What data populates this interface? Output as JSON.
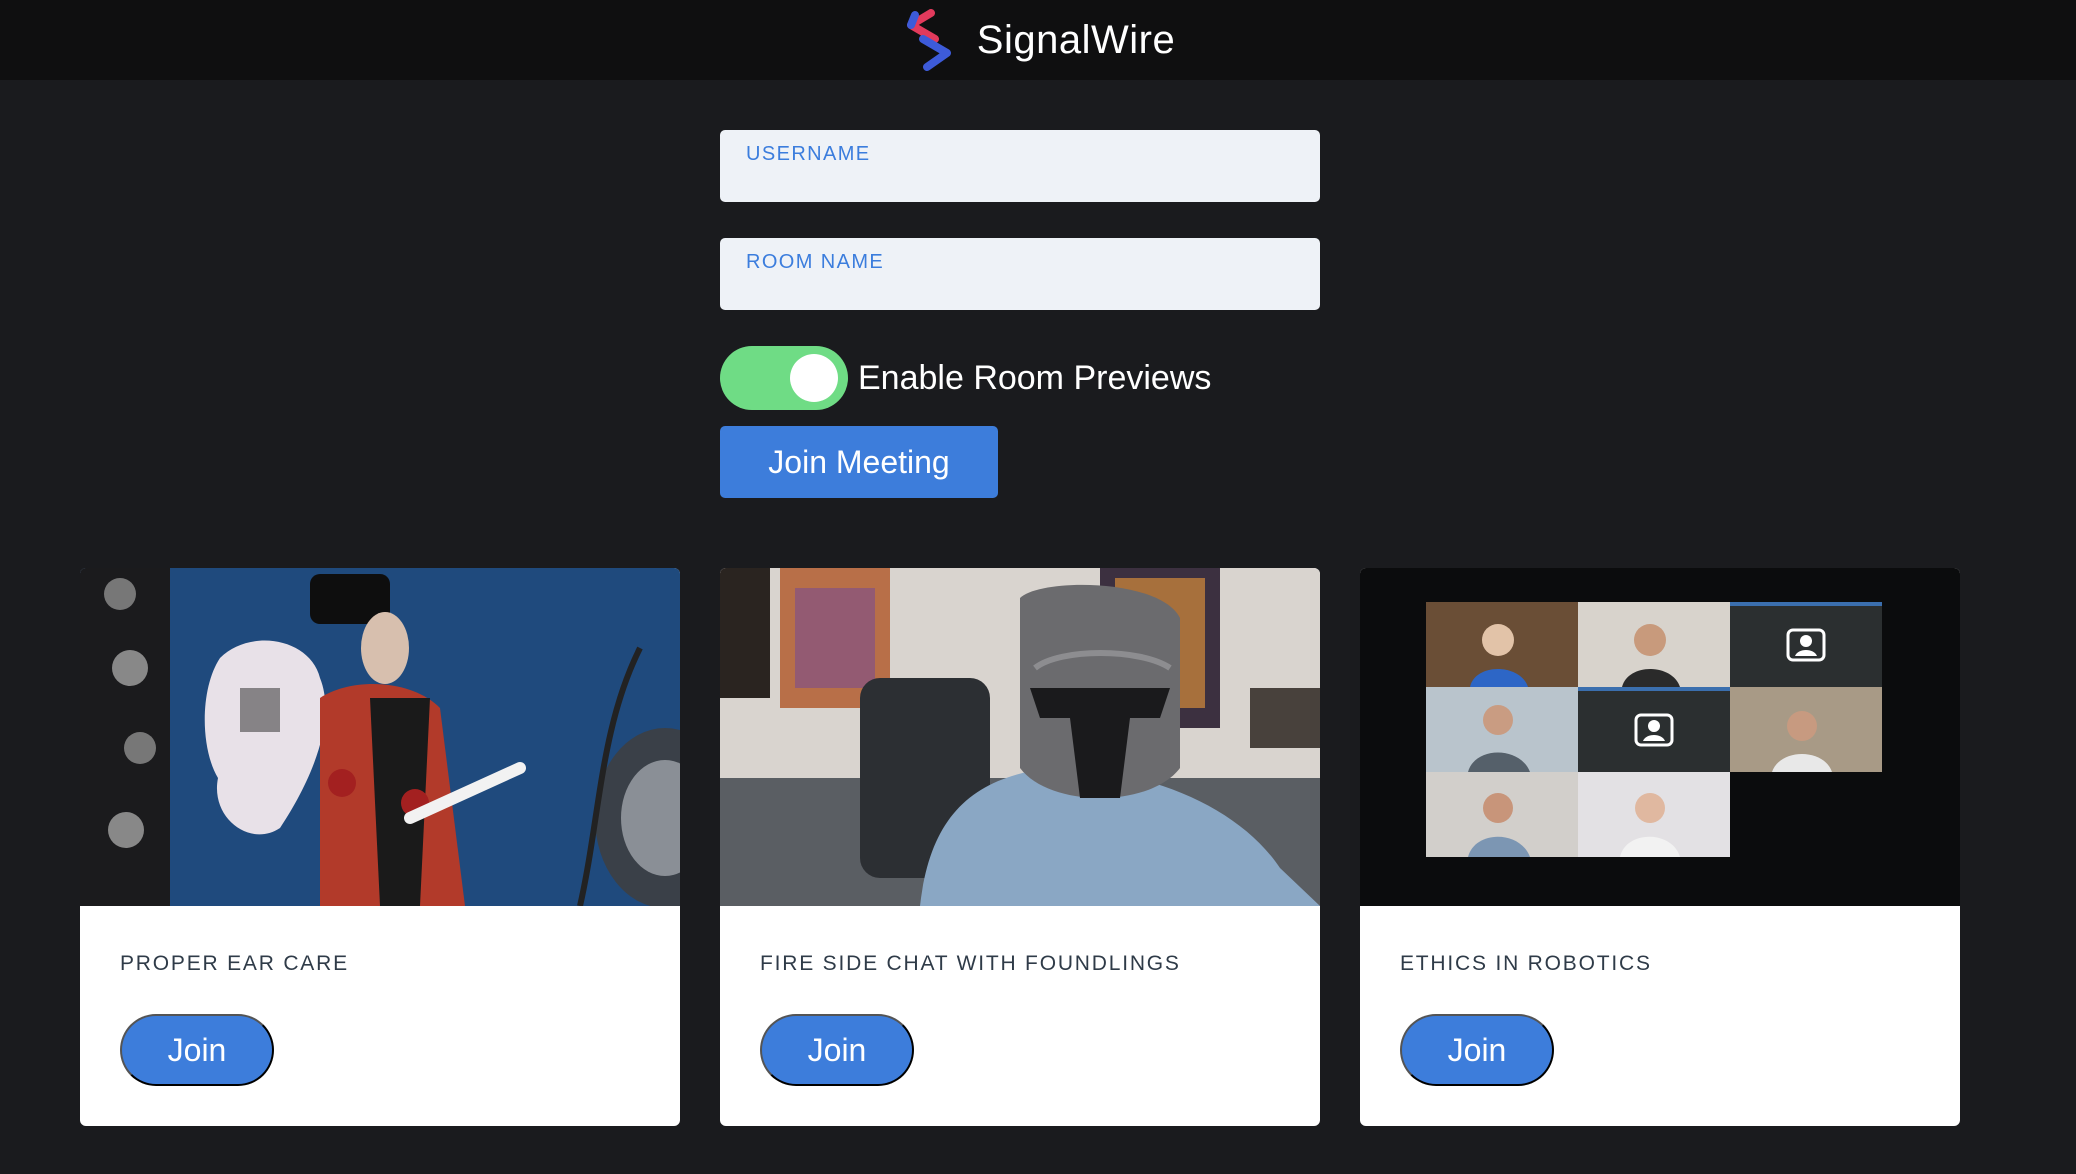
{
  "header": {
    "brand": "SignalWire",
    "logo_icon": "signalwire-logo-icon"
  },
  "form": {
    "username_label": "USERNAME",
    "username_value": "",
    "room_label": "ROOM NAME",
    "room_value": "",
    "previews_label": "Enable Room Previews",
    "previews_enabled": true,
    "join_meeting_label": "Join Meeting"
  },
  "rooms": [
    {
      "title": "PROPER EAR CARE",
      "join_label": "Join"
    },
    {
      "title": "FIRE SIDE CHAT WITH FOUNDLINGS",
      "join_label": "Join"
    },
    {
      "title": "ETHICS IN ROBOTICS",
      "join_label": "Join"
    }
  ],
  "colors": {
    "page_bg": "#1a1b1e",
    "topbar_bg": "#0f0f10",
    "accent_blue": "#3d7ddb",
    "toggle_on": "#6fdc85",
    "field_bg": "#eef2f7"
  }
}
